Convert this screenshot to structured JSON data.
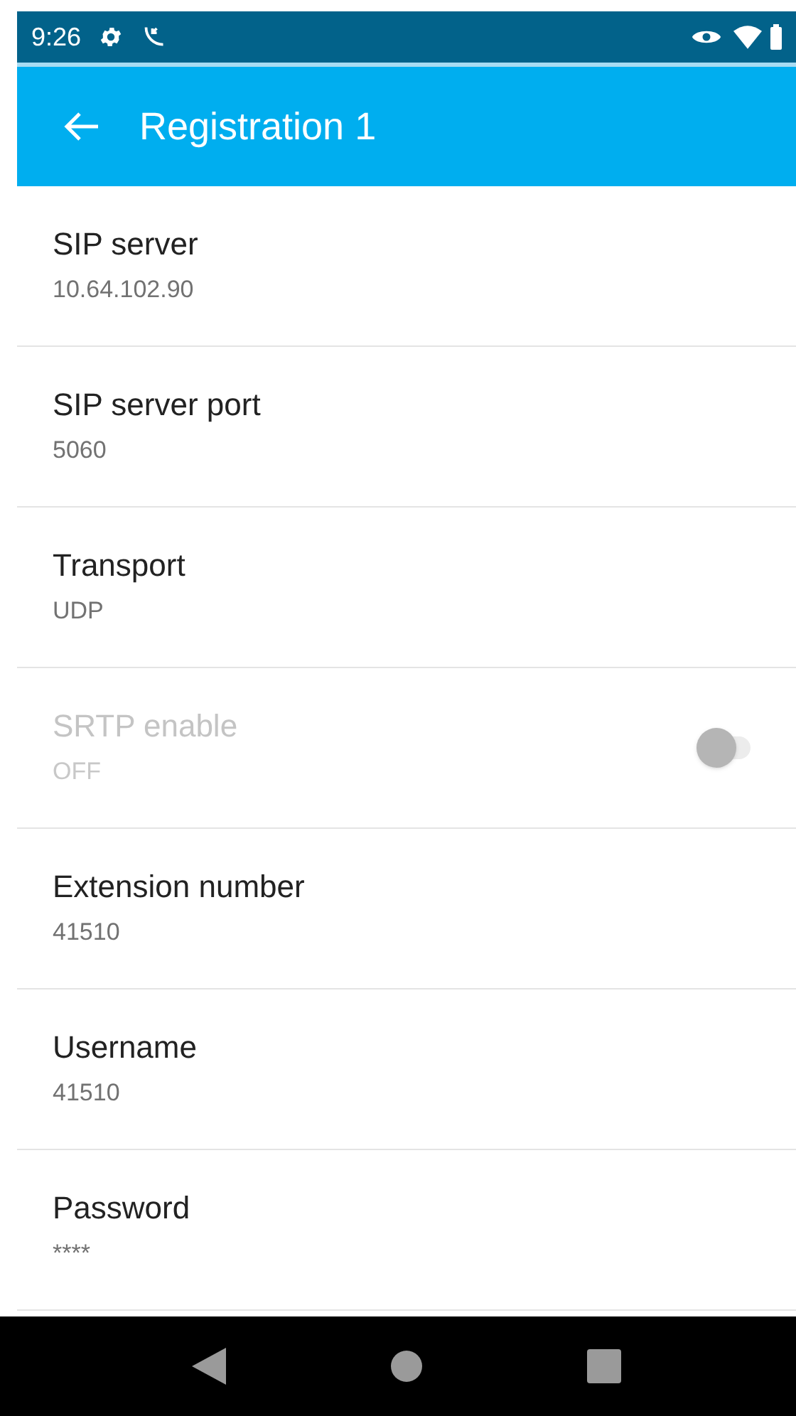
{
  "status_bar": {
    "time": "9:26"
  },
  "app_bar": {
    "title": "Registration 1"
  },
  "settings": [
    {
      "kind": "text",
      "title": "SIP server",
      "value": "10.64.102.90",
      "disabled": false
    },
    {
      "kind": "text",
      "title": "SIP server port",
      "value": "5060",
      "disabled": false
    },
    {
      "kind": "text",
      "title": "Transport",
      "value": "UDP",
      "disabled": false
    },
    {
      "kind": "switch",
      "title": "SRTP enable",
      "value": "OFF",
      "disabled": true,
      "on": false
    },
    {
      "kind": "text",
      "title": "Extension number",
      "value": "41510",
      "disabled": false
    },
    {
      "kind": "text",
      "title": "Username",
      "value": "41510",
      "disabled": false
    },
    {
      "kind": "text",
      "title": "Password",
      "value": "****",
      "disabled": false
    }
  ]
}
